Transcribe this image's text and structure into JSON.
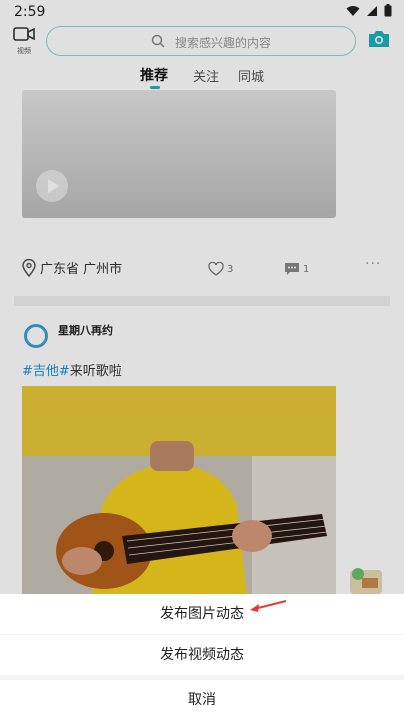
{
  "status": {
    "time": "2:59"
  },
  "topbar": {
    "video_label": "视频",
    "search_placeholder": "搜索感兴趣的内容"
  },
  "tabs": [
    {
      "label": "推荐",
      "active": true
    },
    {
      "label": "关注",
      "active": false
    },
    {
      "label": "同城",
      "active": false
    }
  ],
  "card1": {
    "location": "广东省 广州市",
    "likes": "3",
    "comments": "1"
  },
  "card2": {
    "username": "星期八再约",
    "hashtag": "#吉他#",
    "text": "来听歌啦"
  },
  "action_sheet": {
    "items": [
      "发布图片动态",
      "发布视频动态"
    ],
    "cancel": "取消"
  },
  "colors": {
    "accent": "#1ab2bd",
    "hashtag": "#1a8fd8",
    "arrow": "#e53935"
  }
}
